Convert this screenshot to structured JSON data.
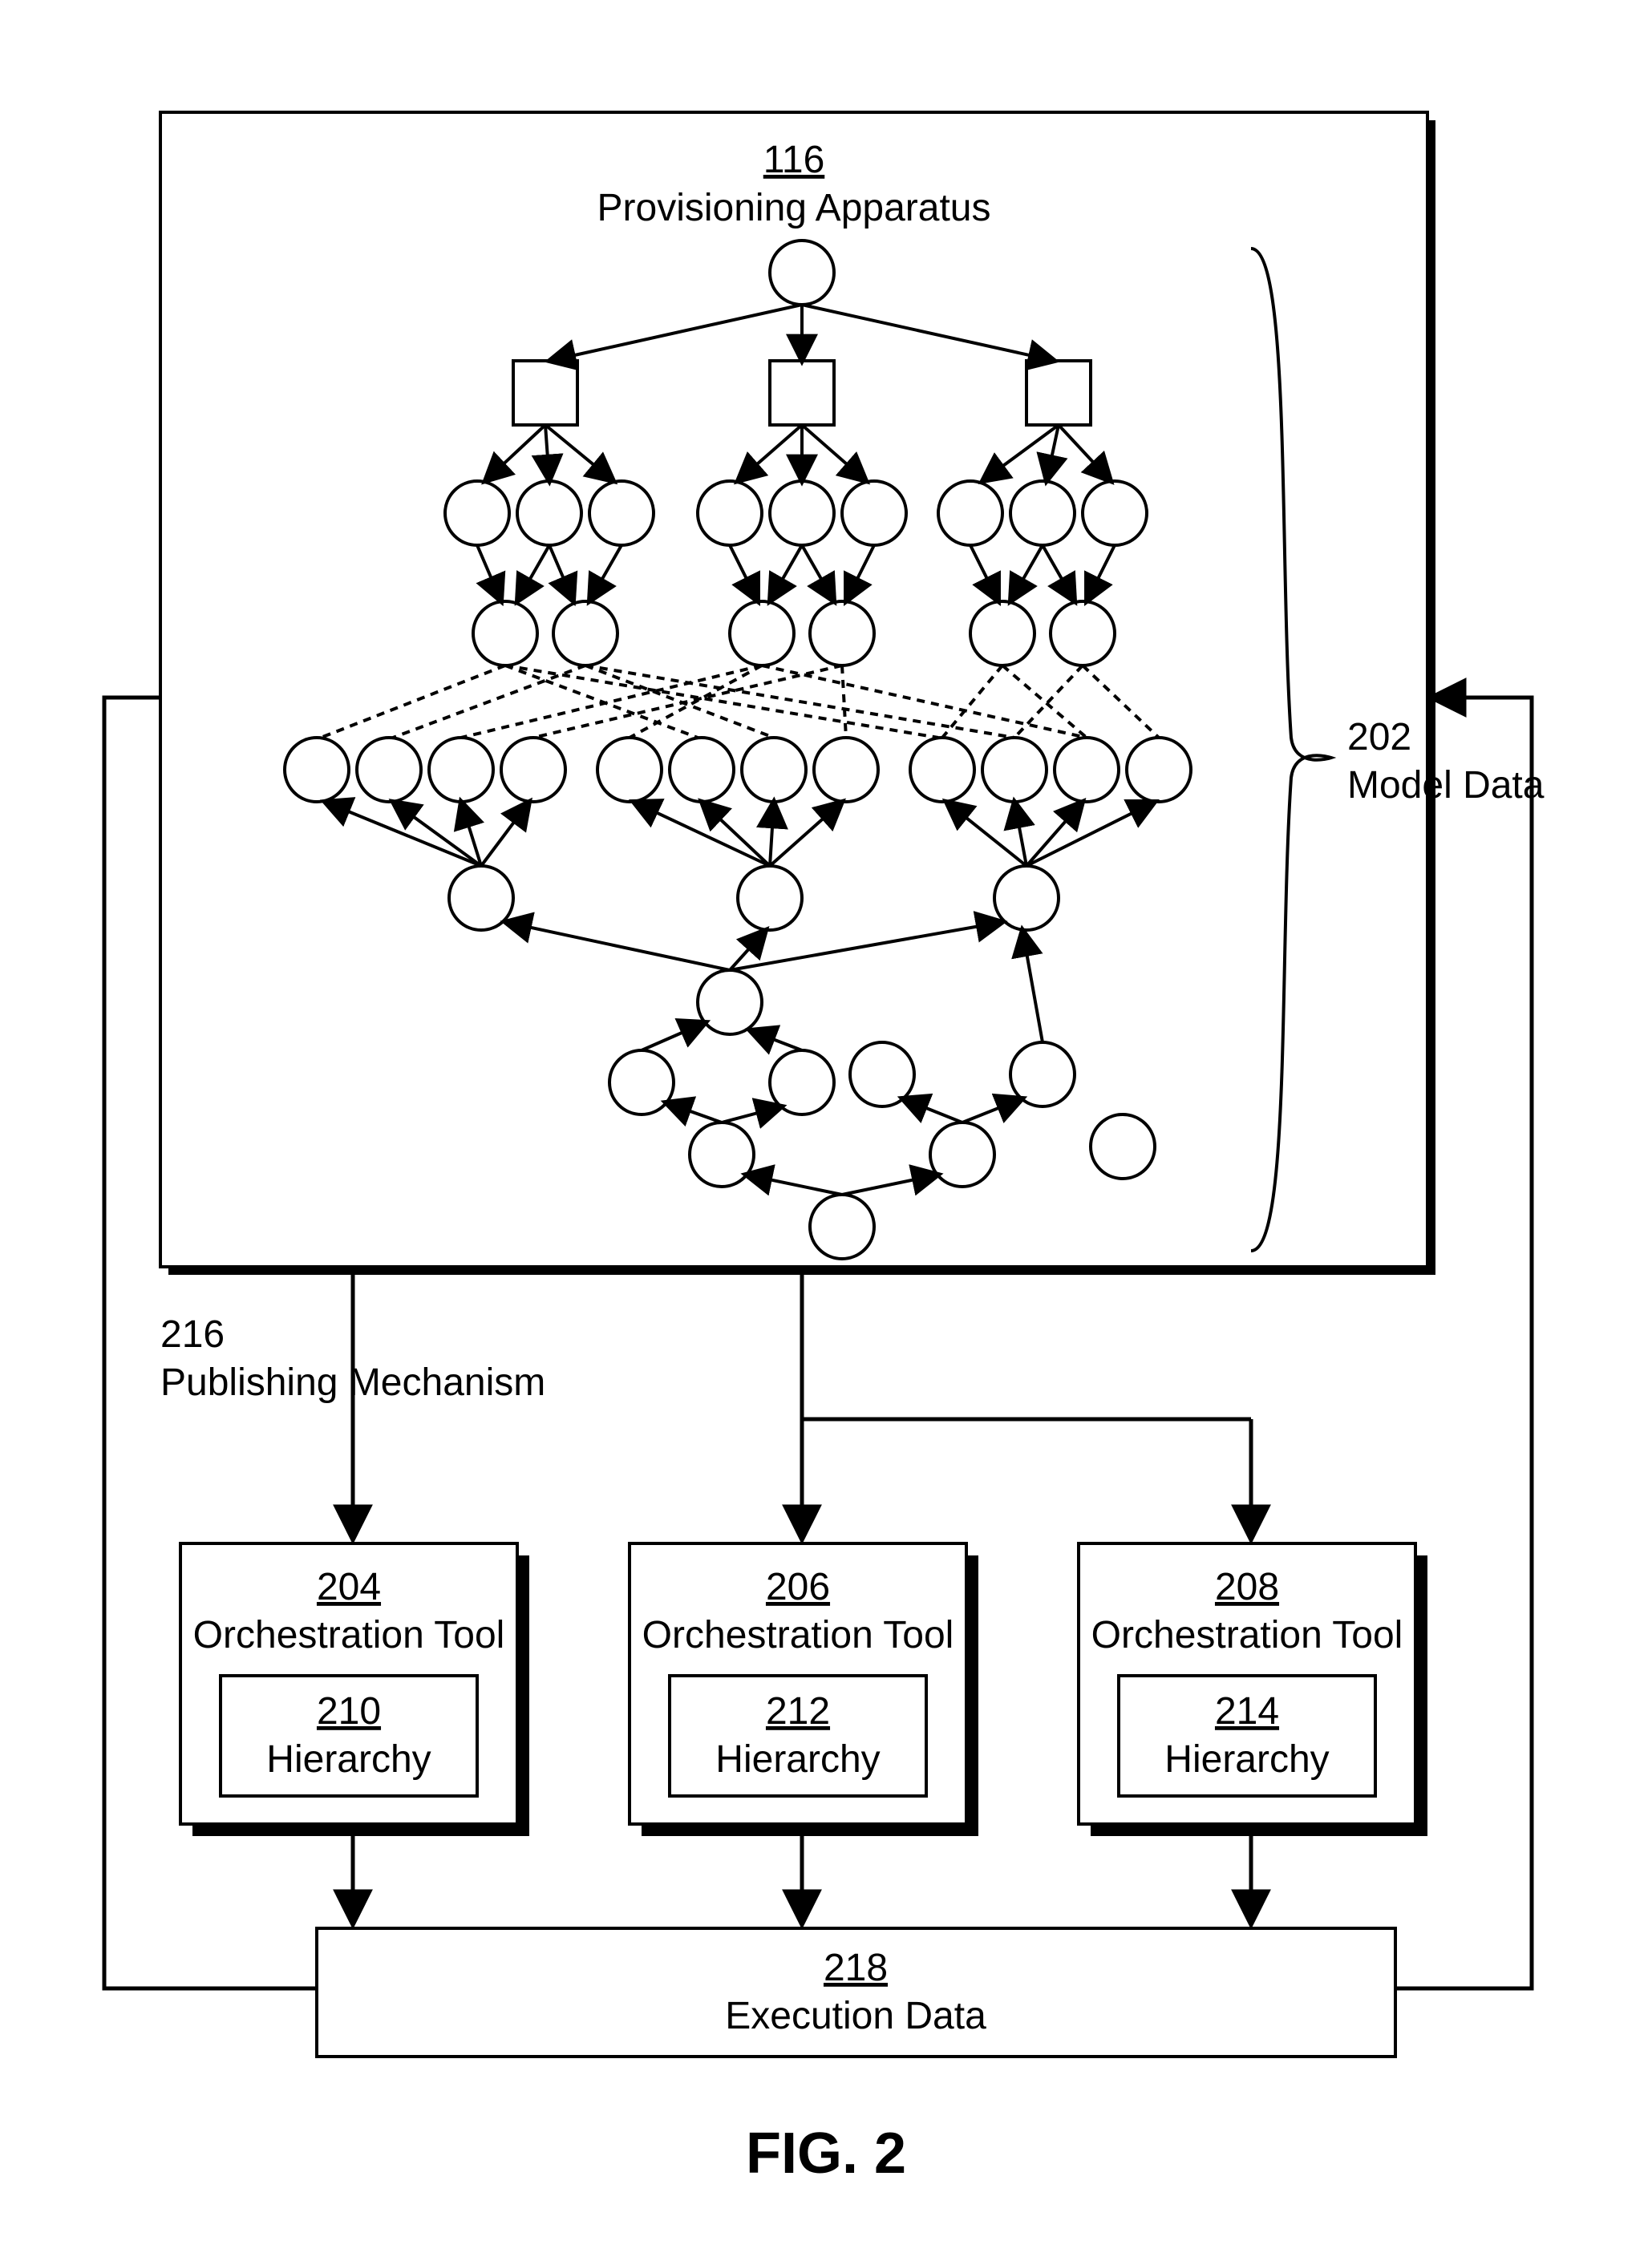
{
  "figure_label": "FIG. 2",
  "provisioning": {
    "ref": "116",
    "label": "Provisioning Apparatus"
  },
  "model_data": {
    "ref": "202",
    "label": "Model Data"
  },
  "publishing": {
    "ref": "216",
    "label": "Publishing Mechanism"
  },
  "tools": [
    {
      "ref": "204",
      "label": "Orchestration Tool",
      "h_ref": "210",
      "h_label": "Hierarchy"
    },
    {
      "ref": "206",
      "label": "Orchestration Tool",
      "h_ref": "212",
      "h_label": "Hierarchy"
    },
    {
      "ref": "208",
      "label": "Orchestration Tool",
      "h_ref": "214",
      "h_label": "Hierarchy"
    }
  ],
  "execution": {
    "ref": "218",
    "label": "Execution Data"
  }
}
